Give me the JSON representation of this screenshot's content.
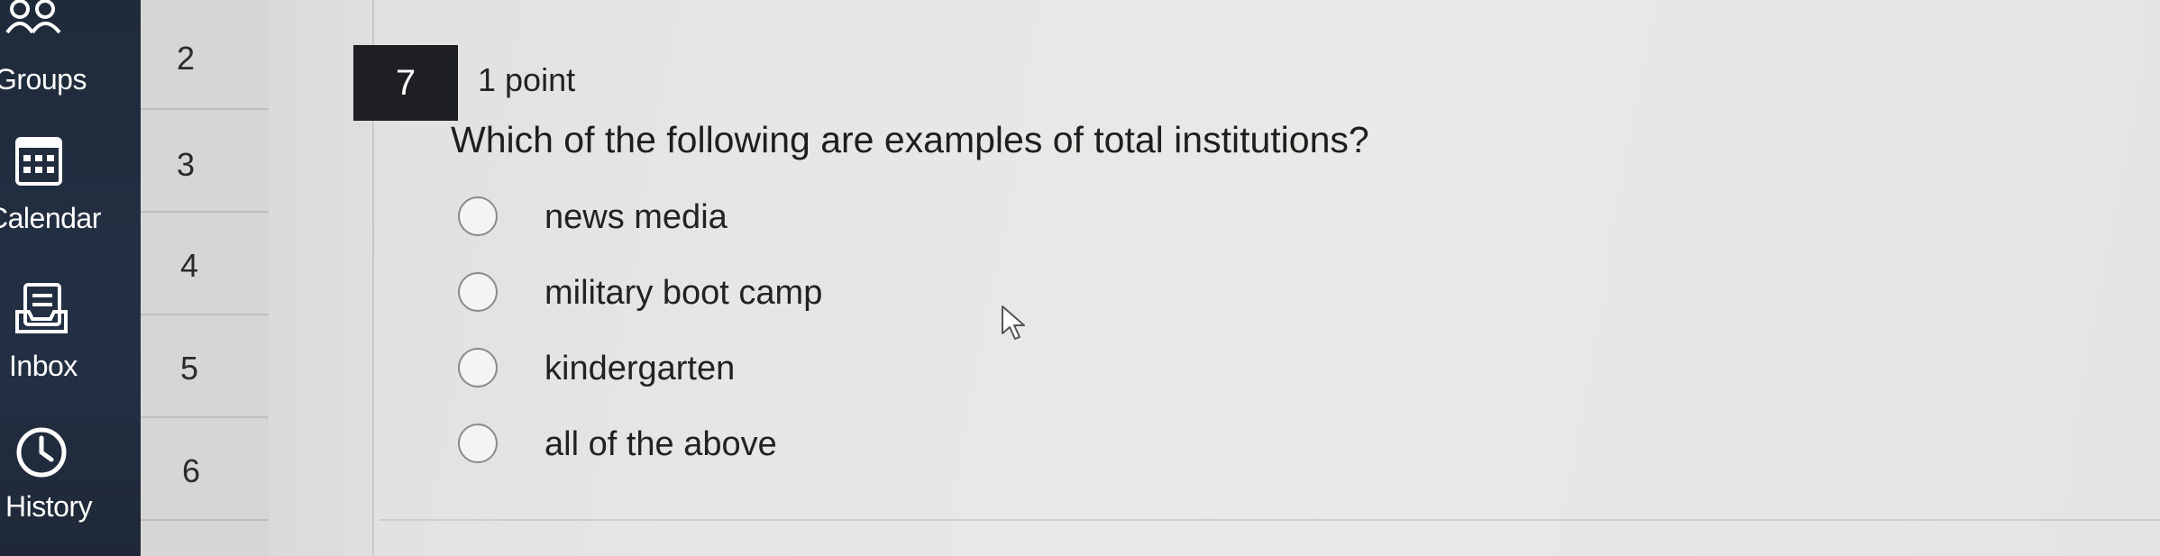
{
  "global_nav": {
    "items": [
      {
        "label": "Groups",
        "icon": "groups-icon"
      },
      {
        "label": "Calendar",
        "icon": "calendar-icon"
      },
      {
        "label": "Inbox",
        "icon": "inbox-icon"
      },
      {
        "label": "History",
        "icon": "history-icon"
      }
    ]
  },
  "question_nav": {
    "numbers": [
      "2",
      "3",
      "4",
      "5",
      "6"
    ]
  },
  "question": {
    "number": "7",
    "points": "1 point",
    "text": "Which of the following are examples of total institutions?",
    "answers": [
      {
        "label": "news media",
        "selected": false
      },
      {
        "label": "military boot camp",
        "selected": false
      },
      {
        "label": "kindergarten",
        "selected": false
      },
      {
        "label": "all of the above",
        "selected": false
      }
    ]
  },
  "colors": {
    "nav_background": "#1f2a3a",
    "question_number_background": "#1d1f22",
    "page_background": "#e6e6e6"
  }
}
